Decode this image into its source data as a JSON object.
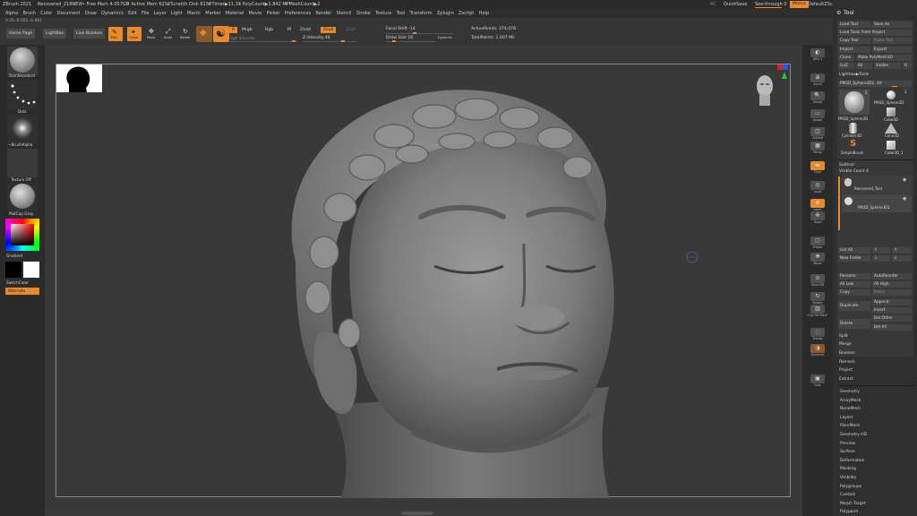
{
  "titlebar": {
    "app": "ZBrush 2021",
    "doc": "Recovered_218NEW",
    "free_mem": "• Free Mem 4.057GB",
    "active_mem": "• Active Mem 6212",
    "scratch": "• Scratch Disk 8158",
    "timer": "• Timer▶11.33",
    "polycount": "• PolyCount▶1.842 MP",
    "meshcount": "• MeshCount▶2",
    "ac": "AC",
    "quicksave": "QuickSave",
    "seethrough": "See-through",
    "seethrough_val": "0",
    "menus_btn": "Menus",
    "default_script": "DefaultZScript"
  },
  "menubar": [
    "Alpha",
    "Brush",
    "Color",
    "Document",
    "Draw",
    "Dynamics",
    "Edit",
    "File",
    "Layer",
    "Light",
    "Macro",
    "Marker",
    "Material",
    "Movie",
    "Picker",
    "Preferences",
    "Render",
    "Stencil",
    "Stroke",
    "Texture",
    "Tool",
    "Transform",
    "Zplugin",
    "Zscript",
    "Help"
  ],
  "coords": "0.35,-0.501,-0.491",
  "toolbar": {
    "home_page": "Home Page",
    "lightbox": "LightBox",
    "live_boolean": "Live Boolean",
    "edit": "Edit",
    "draw": "Draw",
    "move": "Move",
    "scale": "Scale",
    "rotate": "Rotate",
    "a": "A",
    "mrgb": "Mrgb",
    "rgb": "Rgb",
    "m": "M",
    "zadd": "Zadd",
    "zsub": "Zsub",
    "zcut": "Zcut",
    "rgb_intensity": "Rgb Intensity",
    "z_intensity": "Z Intensity 48",
    "focal_shift": "Focal Shift -14",
    "draw_size": "Draw Size 16",
    "dynamic": "Dynamic",
    "active_points": "ActivePoints: 374,078",
    "total_points": "TotalPoints: 1.007 Mil"
  },
  "left_shelf": {
    "brush": "DamStandard",
    "stroke": "Dots",
    "alpha": "~BrushAlpha",
    "texture": "Texture Off",
    "material": "MatCap Gray",
    "gradient": "Gradient",
    "switch_color": "SwitchColor",
    "alternate": "Alternate"
  },
  "right_shelf": [
    "SPix 3",
    "Scroll",
    "Zoom",
    "Actual",
    "AAHalf",
    "Persp",
    "Floor",
    "Local",
    "Lsym",
    "Gxyz",
    "Frame",
    "Move",
    "Zoom3D",
    "Rotate",
    "Line Fill PolyF",
    "Transp",
    "Dynamic",
    "Solo"
  ],
  "tool_panel": {
    "header": "Tool",
    "load_tool": "Load Tool",
    "save_as": "Save As",
    "load_from_project": "Load Tools From Project",
    "copy_tool": "Copy Tool",
    "paste_tool": "Paste Tool",
    "import": "Import",
    "export": "Export",
    "clone": "Clone",
    "make_polymesh": "Make PolyMesh3D",
    "goz": "GoZ",
    "all": "All",
    "visible": "Visible",
    "r": "R",
    "lightbox_tools": "Lightbox▶Tools",
    "current_tool": "PM3D_Sphere3D1. 49",
    "tools": [
      "PM3D_Sphere3D",
      "PM3D_Sphere3D",
      "Cube3D",
      "Cylinder3D",
      "Cone3D",
      "SimpleBrush",
      "Cube3D_1"
    ],
    "tool_counts": [
      "2",
      "2"
    ],
    "subtool_header": "Subtool",
    "visible_count": "Visible Count 4",
    "subtools": [
      "Recovered_Tool",
      "PM3D_Sphere3D1"
    ],
    "list_all": "List All",
    "new_folder": "New Folder",
    "rename": "Rename",
    "autoreorder": "AutoReorder",
    "all_low": "All Low",
    "all_high": "All High",
    "copy": "Copy",
    "paste": "Paste",
    "duplicate": "Duplicate",
    "append": "Append",
    "insert": "Insert",
    "delete": "Delete",
    "del_other": "Del Other",
    "del_all": "Del All",
    "split": "Split",
    "merge": "Merge",
    "boolean": "Boolean",
    "remesh": "Remesh",
    "project": "Project",
    "extract": "Extract",
    "sections": [
      "Geometry",
      "ArrayMesh",
      "NanoMesh",
      "Layers",
      "FiberMesh",
      "Geometry HD",
      "Preview",
      "Surface",
      "Deformation",
      "Masking",
      "Visibility",
      "Polygroups",
      "Contact",
      "Morph Target",
      "Polypaint"
    ]
  }
}
